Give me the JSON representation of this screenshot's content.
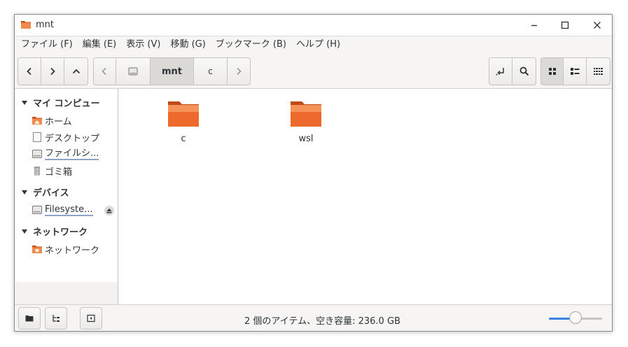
{
  "window": {
    "title": "mnt"
  },
  "menubar": {
    "items": [
      "ファイル (F)",
      "編集 (E)",
      "表示 (V)",
      "移動 (G)",
      "ブックマーク (B)",
      "ヘルプ (H)"
    ]
  },
  "toolbar": {
    "breadcrumb": [
      "mnt",
      "c"
    ],
    "icons": {
      "back": "chevron-left-icon",
      "forward": "chevron-right-icon",
      "up": "chevron-up-icon",
      "location": "location-jump-icon",
      "search": "search-icon",
      "view_icons": "grid-view-icon",
      "view_list": "list-view-icon",
      "view_compact": "compact-view-icon"
    }
  },
  "sidebar": {
    "sections": [
      {
        "title": "マイ コンピュー",
        "items": [
          "ホーム",
          "デスクトップ",
          "ファイルシ...",
          "ゴミ箱"
        ]
      },
      {
        "title": "デバイス",
        "items": [
          "Filesyste..."
        ]
      },
      {
        "title": "ネットワーク",
        "items": [
          "ネットワーク"
        ]
      }
    ]
  },
  "main": {
    "files": [
      {
        "name": "c",
        "type": "folder"
      },
      {
        "name": "wsl",
        "type": "folder"
      }
    ]
  },
  "statusbar": {
    "text": "2 個のアイテム、空き容量: 236.0 GB",
    "zoom_fraction": 0.5
  },
  "colors": {
    "folder": "#e95420",
    "accent": "#3584e4"
  }
}
